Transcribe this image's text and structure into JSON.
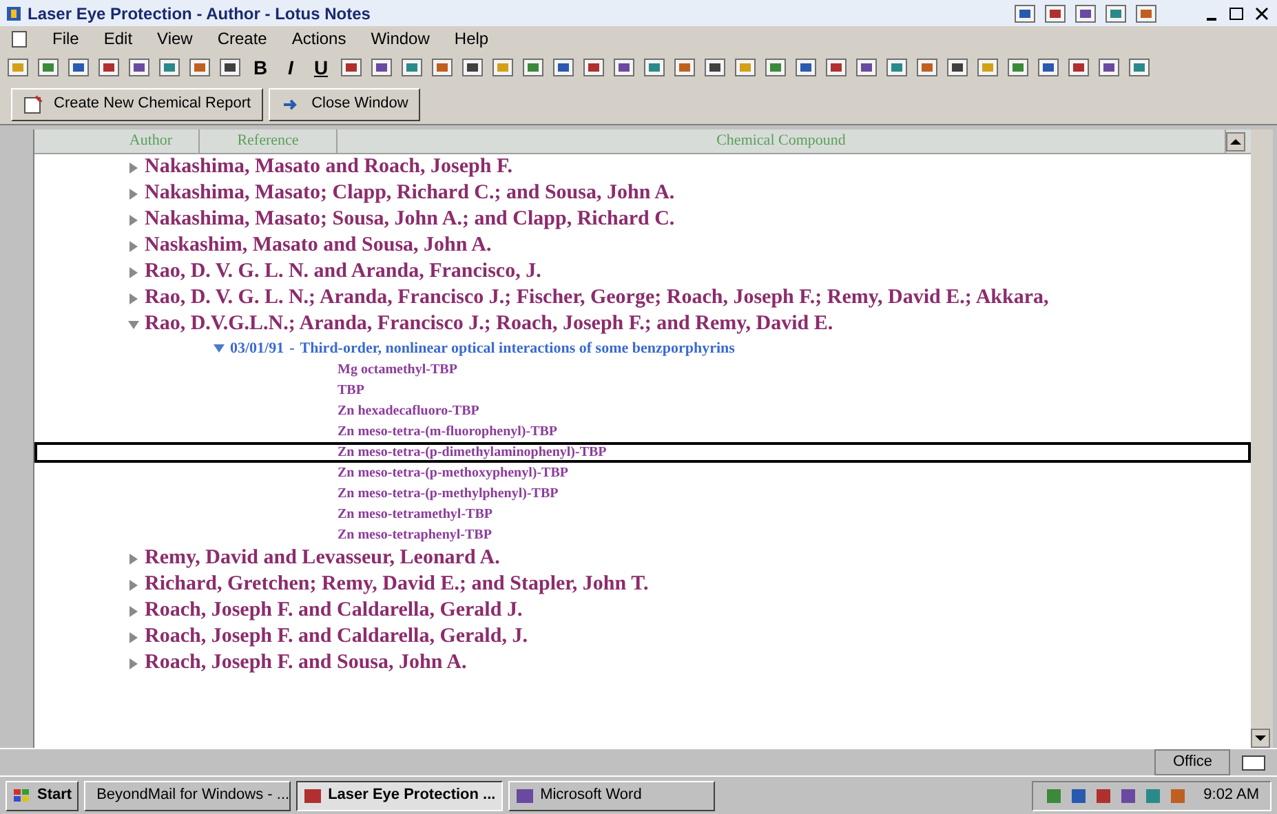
{
  "window": {
    "title": "Laser Eye Protection - Author - Lotus Notes"
  },
  "menu": [
    "File",
    "Edit",
    "View",
    "Create",
    "Actions",
    "Window",
    "Help"
  ],
  "toolbar": {
    "format_buttons": [
      "B",
      "I",
      "U"
    ]
  },
  "action_bar": [
    "Create New Chemical Report",
    "Close Window"
  ],
  "view": {
    "columns": [
      "Author",
      "Reference",
      "Chemical Compound"
    ],
    "rows": [
      {
        "text": "Nakashima, Masato and Roach, Joseph F.",
        "expanded": false
      },
      {
        "text": "Nakashima, Masato; Clapp, Richard C.; and Sousa, John A.",
        "expanded": false
      },
      {
        "text": "Nakashima, Masato; Sousa, John A.; and Clapp, Richard C.",
        "expanded": false
      },
      {
        "text": "Naskashim, Masato and Sousa, John A.",
        "expanded": false
      },
      {
        "text": "Rao, D. V. G. L. N. and Aranda, Francisco, J.",
        "expanded": false
      },
      {
        "text": "Rao, D. V. G. L. N.; Aranda, Francisco J.; Fischer, George; Roach, Joseph F.; Remy, David E.; Akkara,",
        "expanded": false
      },
      {
        "text": "Rao, D.V.G.L.N.; Aranda, Francisco J.; Roach, Joseph F.; and Remy, David E.",
        "expanded": true,
        "children": [
          {
            "date": "03/01/91",
            "separator": "-",
            "title": "Third-order, nonlinear optical interactions of some benzporphyrins",
            "expanded": true,
            "children": [
              {
                "text": "Mg octamethyl-TBP",
                "selected": false
              },
              {
                "text": "TBP",
                "selected": false
              },
              {
                "text": "Zn hexadecafluoro-TBP",
                "selected": false
              },
              {
                "text": "Zn meso-tetra-(m-fluorophenyl)-TBP",
                "selected": false
              },
              {
                "text": "Zn meso-tetra-(p-dimethylaminophenyl)-TBP",
                "selected": true
              },
              {
                "text": "Zn meso-tetra-(p-methoxyphenyl)-TBP",
                "selected": false
              },
              {
                "text": "Zn meso-tetra-(p-methylphenyl)-TBP",
                "selected": false
              },
              {
                "text": "Zn meso-tetramethyl-TBP",
                "selected": false
              },
              {
                "text": "Zn meso-tetraphenyl-TBP",
                "selected": false
              }
            ]
          }
        ]
      },
      {
        "text": "Remy, David and Levasseur, Leonard A.",
        "expanded": false
      },
      {
        "text": "Richard, Gretchen; Remy, David E.; and Stapler, John T.",
        "expanded": false
      },
      {
        "text": "Roach, Joseph F. and Caldarella, Gerald J.",
        "expanded": false
      },
      {
        "text": "Roach, Joseph F. and Caldarella, Gerald, J.",
        "expanded": false
      },
      {
        "text": "Roach, Joseph F. and Sousa, John A.",
        "expanded": false
      }
    ]
  },
  "status_bar": {
    "location": "Office"
  },
  "taskbar": {
    "start": "Start",
    "tasks": [
      {
        "label": "BeyondMail for Windows - ...",
        "selected": false
      },
      {
        "label": "Laser Eye Protection ...",
        "selected": true
      },
      {
        "label": "Microsoft Word",
        "selected": false
      }
    ],
    "clock": "9:02 AM"
  }
}
